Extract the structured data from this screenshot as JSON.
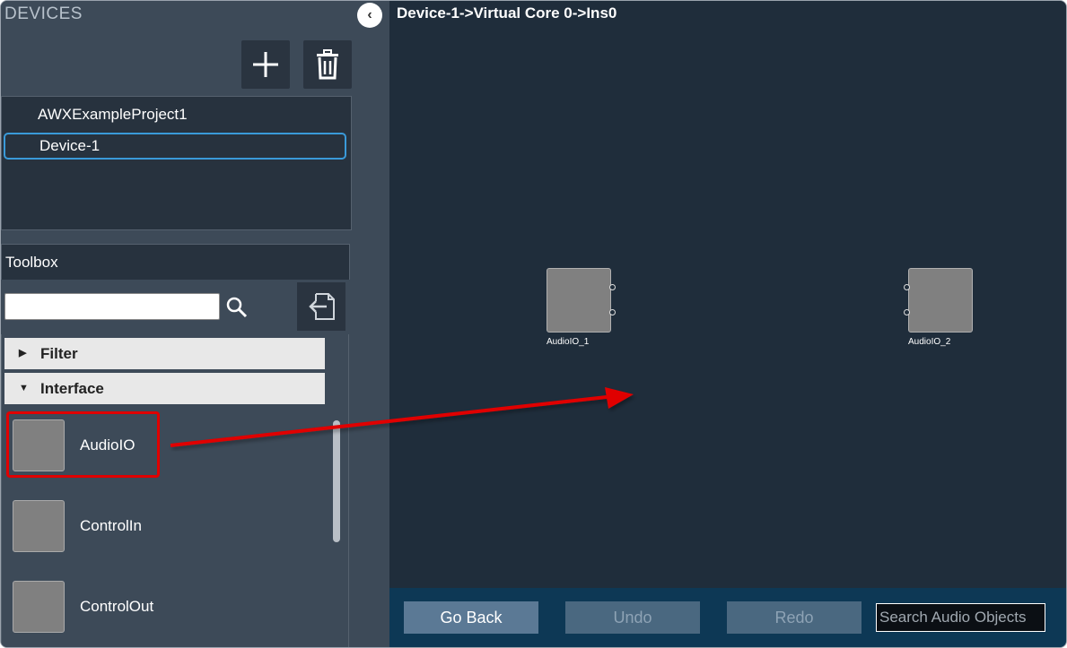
{
  "devices_panel": {
    "title": "DEVICES",
    "collapse_glyph": "‹",
    "add_icon": "plus-icon",
    "delete_icon": "trash-icon",
    "tree": [
      {
        "label": "AWXExampleProject1",
        "selected": false
      },
      {
        "label": "Device-1",
        "selected": true
      }
    ]
  },
  "toolbox": {
    "title": "Toolbox",
    "search_value": "",
    "search_icon": "magnifier-icon",
    "export_icon": "import-export-icon",
    "categories": [
      {
        "label": "Filter",
        "expanded": false,
        "arrow": "▶"
      },
      {
        "label": "Interface",
        "expanded": true,
        "arrow": "▼"
      }
    ],
    "items": [
      {
        "label": "AudioIO",
        "highlighted": true
      },
      {
        "label": "ControlIn",
        "highlighted": false
      },
      {
        "label": "ControlOut",
        "highlighted": false
      }
    ]
  },
  "canvas": {
    "breadcrumb": "Device-1->Virtual Core 0->Ins0",
    "blocks": [
      {
        "label": "AudioIO_1"
      },
      {
        "label": "AudioIO_2"
      }
    ]
  },
  "bottom_bar": {
    "go_back": "Go Back",
    "undo": "Undo",
    "redo": "Redo",
    "search_placeholder": "Search Audio Objects"
  },
  "colors": {
    "highlight": "#e00000",
    "selection": "#3a9ad9",
    "canvas_bg": "#1f2d3b"
  }
}
